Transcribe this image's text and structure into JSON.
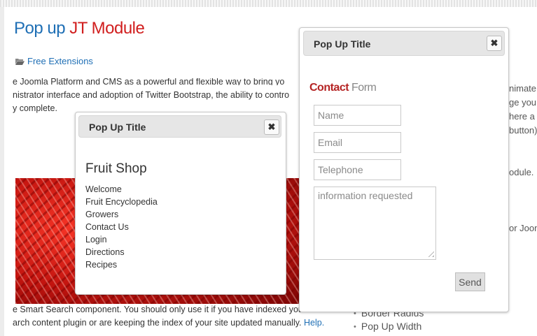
{
  "page": {
    "title_part1": "Pop up",
    "title_part2": "JT Module",
    "category": "Free Extensions",
    "folder_icon": "folder-open-icon",
    "body_line1": "e Joomla Platform and CMS as a powerful and flexible way to bring yo",
    "body_line2": "nistrator interface and adoption of Twitter Bootstrap, the ability to contro",
    "body_line3": "y complete.",
    "bottom_line1": "e Smart Search component. You should only use it if you have indexed your contents",
    "bottom_line2": "arch content plugin or are keeping the index of your site updated manually.",
    "bottom_link": "Help.",
    "right_texts": [
      "nimate",
      "ge you",
      "here a",
      "button)",
      "odule.",
      "or Joom"
    ],
    "list_items": [
      "Border Radius",
      "Pop Up Width"
    ]
  },
  "popup_left": {
    "title": "Pop Up Title",
    "close_icon": "close-icon",
    "shop_title": "Fruit Shop",
    "menu": [
      "Welcome",
      "Fruit Encyclopedia",
      "Growers",
      "Contact Us",
      "Login",
      "Directions",
      "Recipes"
    ]
  },
  "popup_right": {
    "title": "Pop Up Title",
    "close_icon": "close-icon",
    "contact_word1": "Contact",
    "contact_word2": "Form",
    "name_placeholder": "Name",
    "email_placeholder": "Email",
    "telephone_placeholder": "Telephone",
    "message_placeholder": "information requested",
    "send_label": "Send"
  },
  "colors": {
    "title_blue": "#1f6fb5",
    "title_red": "#d11f1f",
    "link": "#1f6fb5",
    "contact_red": "#b52424"
  }
}
